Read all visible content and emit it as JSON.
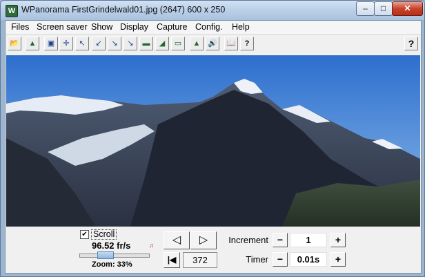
{
  "window": {
    "title": "WPanorama  FirstGrindelwald01.jpg   (2647) 600 x 250",
    "app_icon_glyph": "W",
    "minimize_glyph": "–",
    "maximize_glyph": "□",
    "close_glyph": "✕"
  },
  "menu": {
    "items": [
      "Files",
      "Screen saver",
      "Show",
      "Display",
      "Capture",
      "Config.",
      "Help"
    ]
  },
  "toolbar": {
    "buttons": [
      {
        "name": "open-icon",
        "glyph": "📂"
      },
      {
        "name": "image-icon",
        "glyph": "▲"
      },
      {
        "name": "fit-icon",
        "glyph": "▣"
      },
      {
        "name": "move-icon",
        "glyph": "✛"
      },
      {
        "name": "arrow-up-left-icon",
        "glyph": "↖"
      },
      {
        "name": "arrow-down-left-icon",
        "glyph": "↙"
      },
      {
        "name": "arrow-in-icon",
        "glyph": "↘"
      },
      {
        "name": "arrow-down-right-icon",
        "glyph": "↘"
      },
      {
        "name": "panorama-view-icon",
        "glyph": "▬"
      },
      {
        "name": "landscape-icon",
        "glyph": "◢"
      },
      {
        "name": "strip-icon",
        "glyph": "▭"
      },
      {
        "name": "mountain-icon",
        "glyph": "▲"
      },
      {
        "name": "sound-icon",
        "glyph": "🔊"
      },
      {
        "name": "book-icon",
        "glyph": "📖"
      },
      {
        "name": "help-topic-icon",
        "glyph": "?"
      }
    ],
    "help_label": "?"
  },
  "controls": {
    "scroll_checked": true,
    "scroll_check_glyph": "✔",
    "scroll_label": "Scroll",
    "fps": "96.52 fr/s",
    "zoom_label": "Zoom: 33%",
    "zoom_fraction": 0.33,
    "prev_glyph": "◁",
    "next_glyph": "▷",
    "first_glyph": "|◀",
    "position": "372",
    "increment_label": "Increment",
    "increment_value": "1",
    "timer_label": "Timer",
    "timer_value": "0.01s",
    "minus": "−",
    "plus": "+"
  }
}
